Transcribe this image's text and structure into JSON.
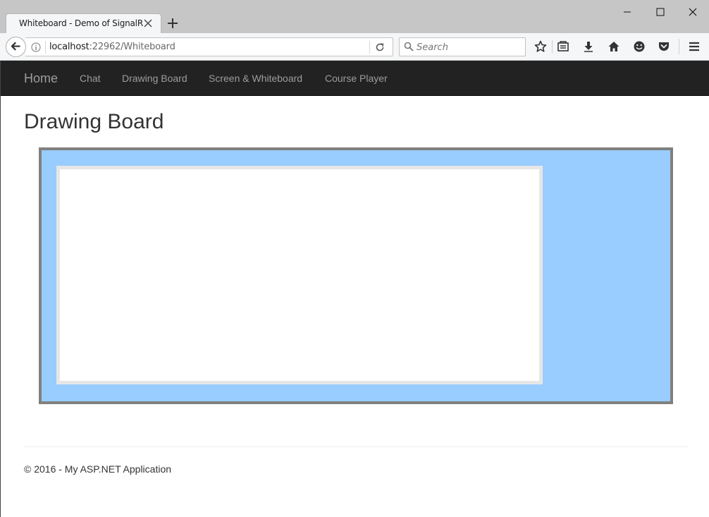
{
  "browser": {
    "tab": {
      "title": "Whiteboard - Demo of SignalR"
    },
    "url": {
      "host": "localhost",
      "rest": ":22962/Whiteboard"
    },
    "search": {
      "placeholder": "Search"
    },
    "icons": {
      "close_tab": "close-icon",
      "new_tab": "plus-icon",
      "back": "back-arrow-icon",
      "info": "info-icon",
      "reload": "reload-icon",
      "search": "search-icon",
      "bookmark": "star-icon",
      "reading_list": "reading-list-icon",
      "downloads": "download-icon",
      "home": "home-icon",
      "hello": "smiley-icon",
      "pocket": "pocket-icon",
      "menu": "hamburger-menu-icon"
    }
  },
  "navbar": {
    "brand": "Home",
    "links": [
      "Chat",
      "Drawing Board",
      "Screen & Whiteboard",
      "Course Player"
    ]
  },
  "main": {
    "title": "Drawing Board"
  },
  "footer": {
    "text": "© 2016 - My ASP.NET Application"
  },
  "colors": {
    "navbar_bg": "#222222",
    "nav_text": "#9d9d9d",
    "board_bg": "#99ccff",
    "board_border": "#808080",
    "canvas_bg": "#ffffff"
  }
}
